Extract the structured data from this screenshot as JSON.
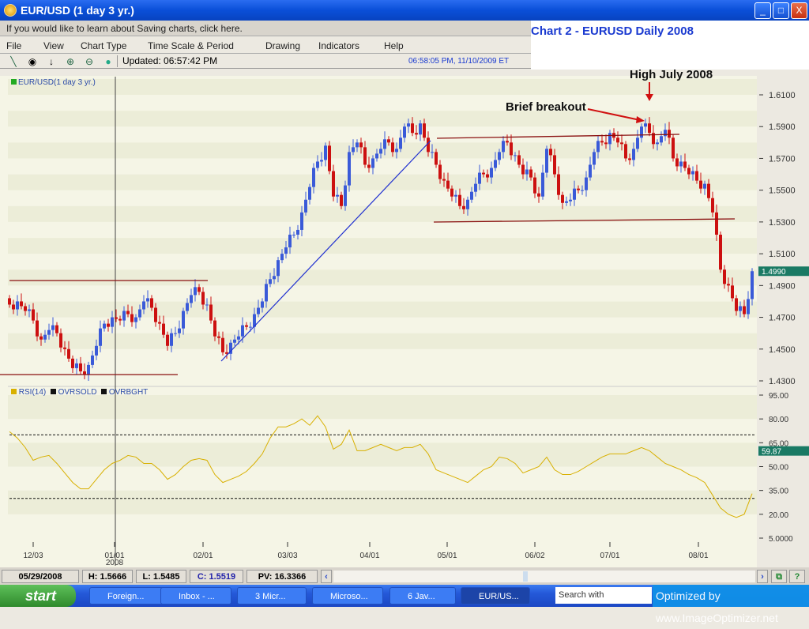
{
  "window": {
    "title": "EUR/USD (1 day  3 yr.)",
    "minimize": "_",
    "maximize": "□",
    "close": "X"
  },
  "infobar": {
    "text": "If you would like to learn about Saving charts, click here."
  },
  "menu": [
    "File",
    "View",
    "Chart Type",
    "Time Scale & Period",
    "Drawing",
    "Indicators",
    "Help"
  ],
  "toolbar": {
    "updated": "Updated: 06:57:42 PM",
    "clock": "06:58:05 PM, 11/10/2009 ET",
    "icons": [
      "draw-line-icon",
      "crosshair-icon",
      "arrow-down-icon",
      "zoom-in-icon",
      "zoom-out-icon",
      "status-dot-icon"
    ]
  },
  "annotations": {
    "heading": "Chart 2 - EURUSD Daily 2008",
    "high": "High July 2008",
    "breakout": "Brief breakout"
  },
  "chart_data": [
    {
      "type": "candlestick",
      "legend": "EUR/USD(1 day  3 yr.)",
      "ylim": [
        1.43,
        1.61
      ],
      "yticks": [
        "1.6100",
        "1.5900",
        "1.5700",
        "1.5500",
        "1.5300",
        "1.5100",
        "1.4900",
        "1.4700",
        "1.4500",
        "1.4300"
      ],
      "last_value": "1.4990",
      "xticks": [
        "12/03",
        "01/01\n2008",
        "02/01",
        "03/03",
        "04/01",
        "05/01",
        "06/02",
        "07/01",
        "08/01"
      ],
      "colors": {
        "up": "#3a5ad8",
        "down": "#cc1010",
        "trend_red": "#8a1010",
        "trend_blue": "#2030d0"
      },
      "closes": [
        1.478,
        1.48,
        1.474,
        1.468,
        1.456,
        1.462,
        1.46,
        1.45,
        1.438,
        1.436,
        1.44,
        1.452,
        1.466,
        1.47,
        1.468,
        1.472,
        1.47,
        1.48,
        1.476,
        1.466,
        1.452,
        1.46,
        1.474,
        1.484,
        1.486,
        1.478,
        1.458,
        1.448,
        1.454,
        1.458,
        1.464,
        1.472,
        1.48,
        1.494,
        1.506,
        1.514,
        1.522,
        1.536,
        1.552,
        1.568,
        1.578,
        1.546,
        1.54,
        1.574,
        1.58,
        1.566,
        1.57,
        1.576,
        1.58,
        1.576,
        1.59,
        1.586,
        1.592,
        1.574,
        1.566,
        1.556,
        1.546,
        1.54,
        1.544,
        1.554,
        1.56,
        1.564,
        1.574,
        1.58,
        1.572,
        1.56,
        1.558,
        1.546,
        1.576,
        1.56,
        1.542,
        1.544,
        1.55,
        1.558,
        1.574,
        1.58,
        1.586,
        1.58,
        1.57,
        1.576,
        1.59,
        1.586,
        1.58,
        1.588,
        1.57,
        1.568,
        1.56,
        1.556,
        1.554,
        1.536,
        1.5,
        1.49,
        1.474,
        1.472,
        1.499
      ]
    },
    {
      "type": "line",
      "legend": [
        "RSI(14)",
        "OVRSOLD",
        "OVRBGHT"
      ],
      "ylim": [
        5,
        95
      ],
      "yticks": [
        "95.00",
        "80.00",
        "65.00",
        "50.00",
        "35.00",
        "20.00",
        "5.0000"
      ],
      "overbought": 70,
      "oversold": 30,
      "last_value": "59.87",
      "color": "#d8b000",
      "values": [
        72,
        68,
        62,
        54,
        56,
        57,
        52,
        46,
        40,
        36,
        36,
        42,
        48,
        52,
        54,
        57,
        56,
        52,
        52,
        48,
        42,
        45,
        50,
        54,
        55,
        54,
        45,
        40,
        42,
        44,
        47,
        52,
        58,
        68,
        75,
        75,
        77,
        80,
        76,
        82,
        75,
        61,
        64,
        73,
        60,
        60,
        62,
        64,
        62,
        60,
        62,
        62,
        64,
        58,
        48,
        46,
        44,
        42,
        40,
        44,
        48,
        50,
        56,
        55,
        52,
        46,
        48,
        50,
        56,
        48,
        45,
        45,
        47,
        50,
        53,
        56,
        58,
        58,
        58,
        60,
        62,
        60,
        56,
        52,
        50,
        48,
        45,
        43,
        40,
        32,
        24,
        20,
        18,
        20,
        33
      ]
    }
  ],
  "status": {
    "date": "05/29/2008",
    "high": "H: 1.5666",
    "low": "L: 1.5485",
    "close": "C: 1.5519",
    "pv": "PV: 16.3366"
  },
  "taskbar": {
    "start": "start",
    "items": [
      "Foreign...",
      "Inbox - ...",
      "3 Micr...",
      "Microso...",
      "6 Jav...",
      "EUR/US..."
    ],
    "search": "Search with",
    "tray": "Optimized by www.ImageOptimizer.net"
  }
}
